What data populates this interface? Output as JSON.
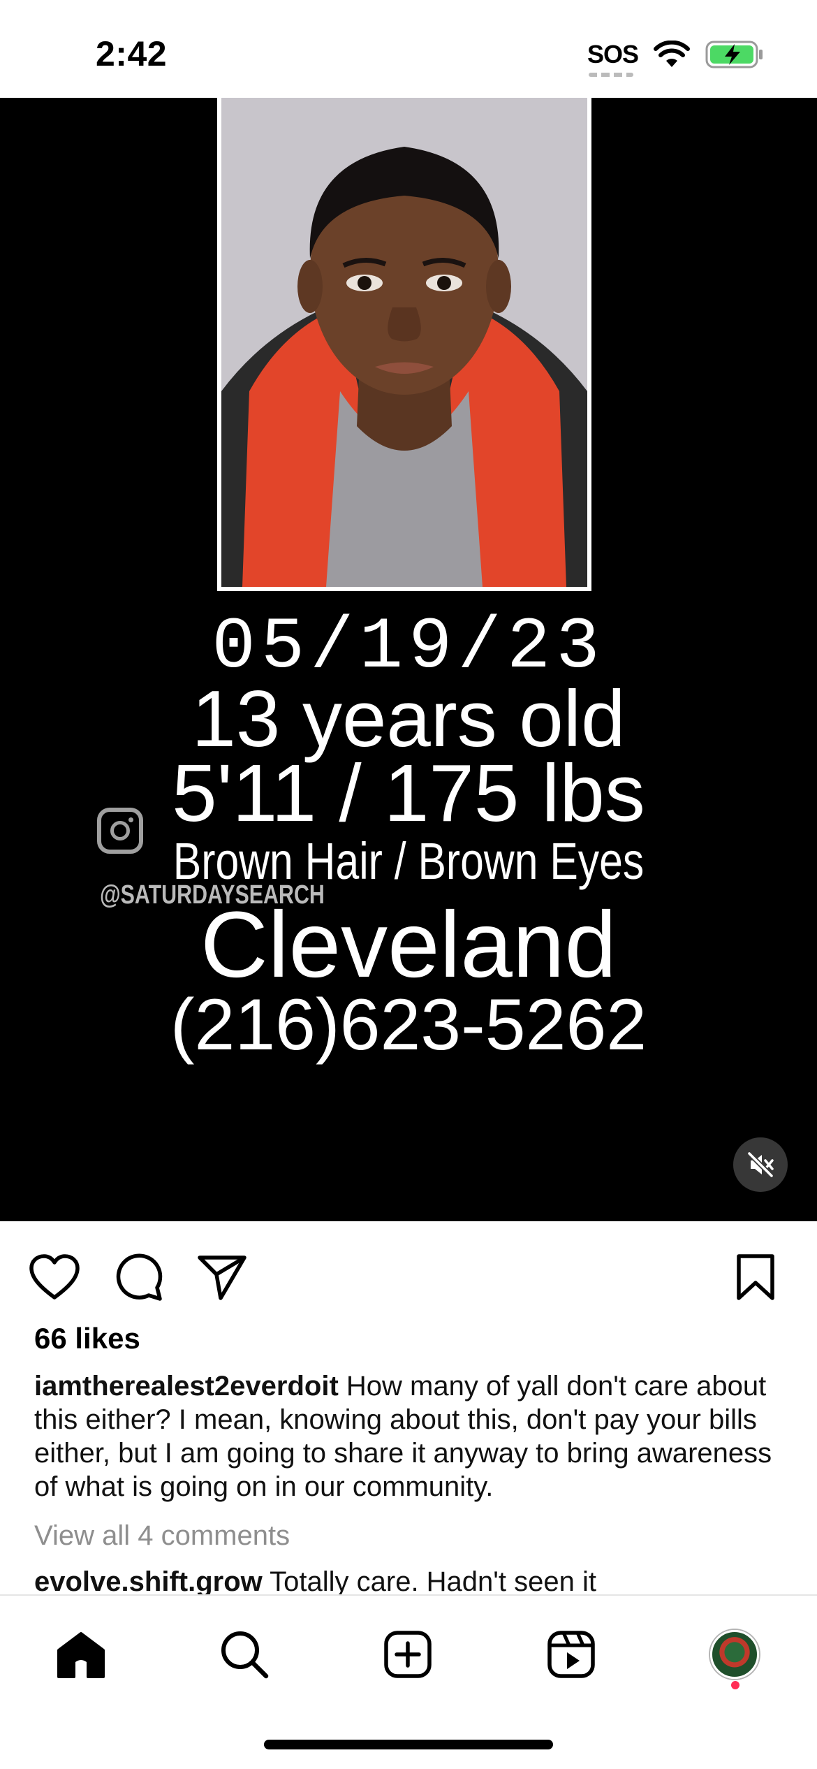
{
  "status_bar": {
    "time": "2:42",
    "sos": "SOS",
    "icons": [
      "wifi-icon",
      "battery-charging-icon"
    ],
    "battery_color": "#4cd964"
  },
  "post": {
    "media": {
      "overlay_lines": [
        "05/19/23",
        "13 years old",
        "5'11 / 175 lbs",
        "Brown Hair / Brown Eyes",
        "Cleveland",
        "(216)623-5262"
      ],
      "watermark": "@SATURDAYSEARCH",
      "icons": [
        "instagram-logo-icon",
        "mute-icon"
      ]
    },
    "actions": [
      "heart-icon",
      "comment-icon",
      "share-icon",
      "bookmark-icon"
    ],
    "likes": "66 likes",
    "caption": {
      "username": "iamtherealest2everdoit",
      "text": "How many of yall don't care about this either? I mean, knowing about this, don't pay your bills either, but I am going to share it anyway to bring awareness of what is going on in our community."
    },
    "view_comments": "View all 4 comments",
    "comment_preview": {
      "username": "evolve.shift.grow",
      "text": "Totally care. Hadn't seen it"
    }
  },
  "tab_bar": {
    "tabs": [
      "home-icon",
      "search-icon",
      "create-post-icon",
      "reels-icon",
      "profile-avatar"
    ]
  }
}
